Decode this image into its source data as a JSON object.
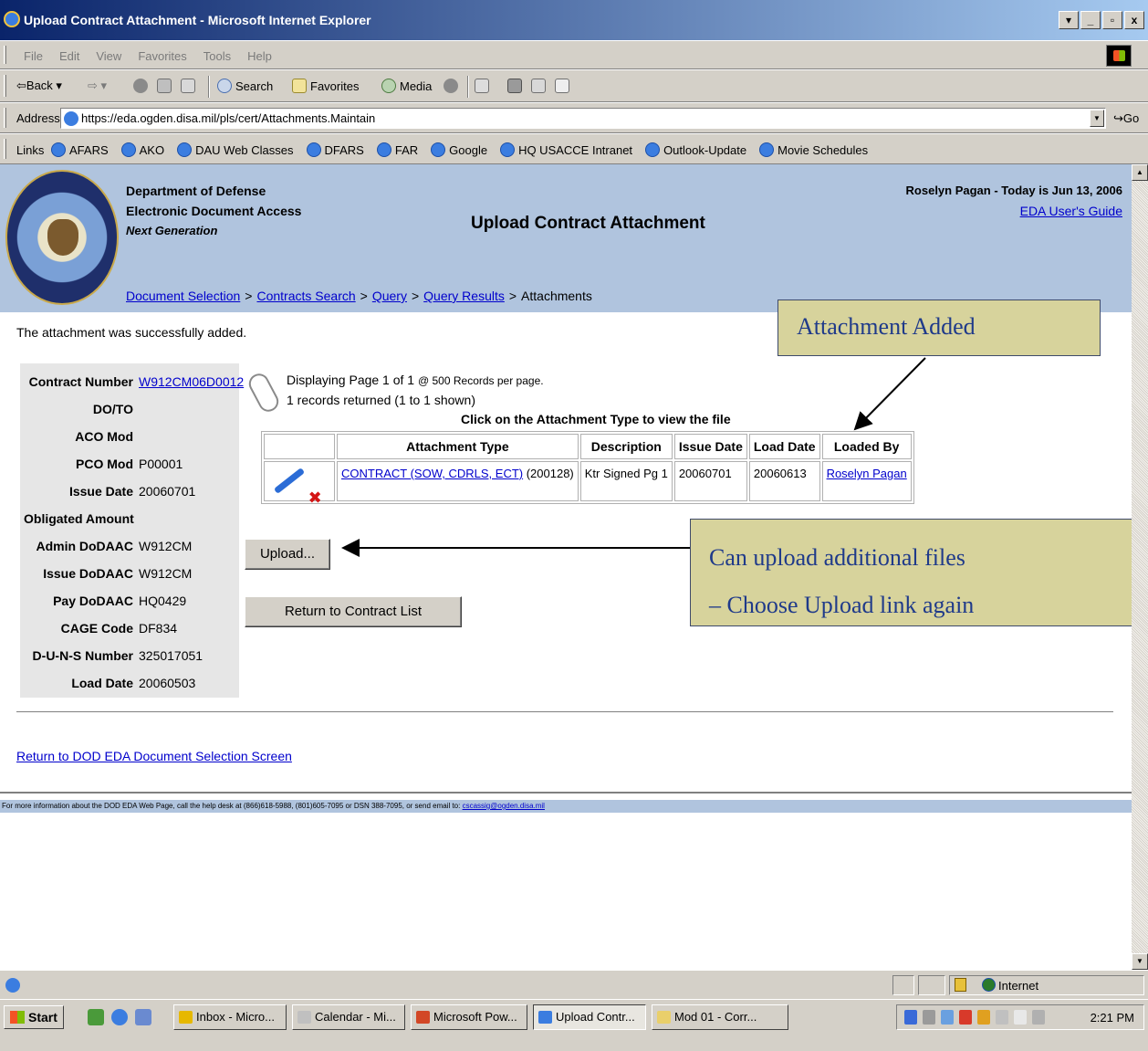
{
  "window": {
    "title": "Upload Contract Attachment - Microsoft Internet Explorer",
    "buttons": [
      "▾",
      "_",
      "▫",
      "x"
    ]
  },
  "menu": [
    "File",
    "Edit",
    "View",
    "Favorites",
    "Tools",
    "Help"
  ],
  "toolbar": {
    "back": "⇦Back ▾",
    "forward": "⇨ ▾",
    "search": "Search",
    "favorites": "Favorites",
    "media": "Media"
  },
  "address": {
    "label": "Address",
    "url": "https://eda.ogden.disa.mil/pls/cert/Attachments.Maintain",
    "go": "Go"
  },
  "links": {
    "label": "Links",
    "items": [
      "AFARS",
      "AKO",
      "DAU Web Classes",
      "DFARS",
      "FAR",
      "Google",
      "HQ USACCE Intranet",
      "Outlook-Update",
      "Movie Schedules"
    ]
  },
  "header": {
    "org_line1": "Department of Defense",
    "org_line2": "Electronic Document Access",
    "org_line3": "Next Generation",
    "title": "Upload Contract Attachment",
    "user_line": "Roselyn Pagan - Today is Jun 13, 2006",
    "guide_link": "EDA User's Guide"
  },
  "breadcrumb": [
    "Document Selection",
    "Contracts Search",
    "Query",
    "Query Results",
    "Attachments"
  ],
  "message": "The attachment was successfully added.",
  "contract": {
    "rows": [
      {
        "label": "Contract Number",
        "value": "W912CM06D0012"
      },
      {
        "label": "DO/TO",
        "value": ""
      },
      {
        "label": "ACO Mod",
        "value": ""
      },
      {
        "label": "PCO Mod",
        "value": "P00001"
      },
      {
        "label": "Issue Date",
        "value": "20060701"
      },
      {
        "label": "Obligated Amount",
        "value": ""
      },
      {
        "label": "Admin DoDAAC",
        "value": "W912CM"
      },
      {
        "label": "Issue DoDAAC",
        "value": "W912CM"
      },
      {
        "label": "Pay DoDAAC",
        "value": "HQ0429"
      },
      {
        "label": "CAGE Code",
        "value": "DF834"
      },
      {
        "label": "D-U-N-S Number",
        "value": "325017051"
      },
      {
        "label": "Load Date",
        "value": "20060503"
      }
    ]
  },
  "paging": {
    "line1": "Displaying Page 1 of 1",
    "line1_small": "@ 500 Records per page.",
    "line2": "1 records returned (1 to 1 shown)",
    "hint": "Click on the Attachment Type to view the file"
  },
  "table": {
    "headers": [
      "",
      "Attachment Type",
      "Description",
      "Issue Date",
      "Load Date",
      "Loaded By"
    ],
    "row": {
      "delete": "✖",
      "type_link": "CONTRACT (SOW, CDRLS, ECT)",
      "type_code": " (200128)",
      "description": "Ktr Signed Pg 1",
      "issue_date": "20060701",
      "load_date": "20060613",
      "loaded_by": "Roselyn Pagan"
    }
  },
  "buttons": {
    "upload": "Upload...",
    "return": "Return to Contract List"
  },
  "callouts": {
    "added": "Attachment Added",
    "upload_line1": "Can upload additional files",
    "upload_line2": "– Choose Upload link again"
  },
  "return_link": "Return to DOD EDA Document Selection Screen",
  "footer": {
    "text": "For more information about the DOD EDA Web Page, call the help desk at (866)618-5988, (801)605-7095 or DSN 388-7095, or send email to: ",
    "email": "cscassig@ogden.disa.mil"
  },
  "status": {
    "zone": "Internet"
  },
  "taskbar": {
    "start": "Start",
    "tasks": [
      "Inbox - Micro...",
      "Calendar - Mi...",
      "Microsoft Pow...",
      "Upload Contr...",
      "Mod 01 - Corr..."
    ],
    "clock": "2:21 PM"
  },
  "icons": {
    "ie": "ie-globe-icon",
    "attachment": "paperclip-icon",
    "edit": "pen-icon",
    "delete": "red-x-icon"
  },
  "colors": {
    "header_bg": "#b0c4de",
    "callout_bg": "#d7d39c",
    "callout_text": "#1f3a8a",
    "link": "#0000cc",
    "delete": "#d41414"
  }
}
